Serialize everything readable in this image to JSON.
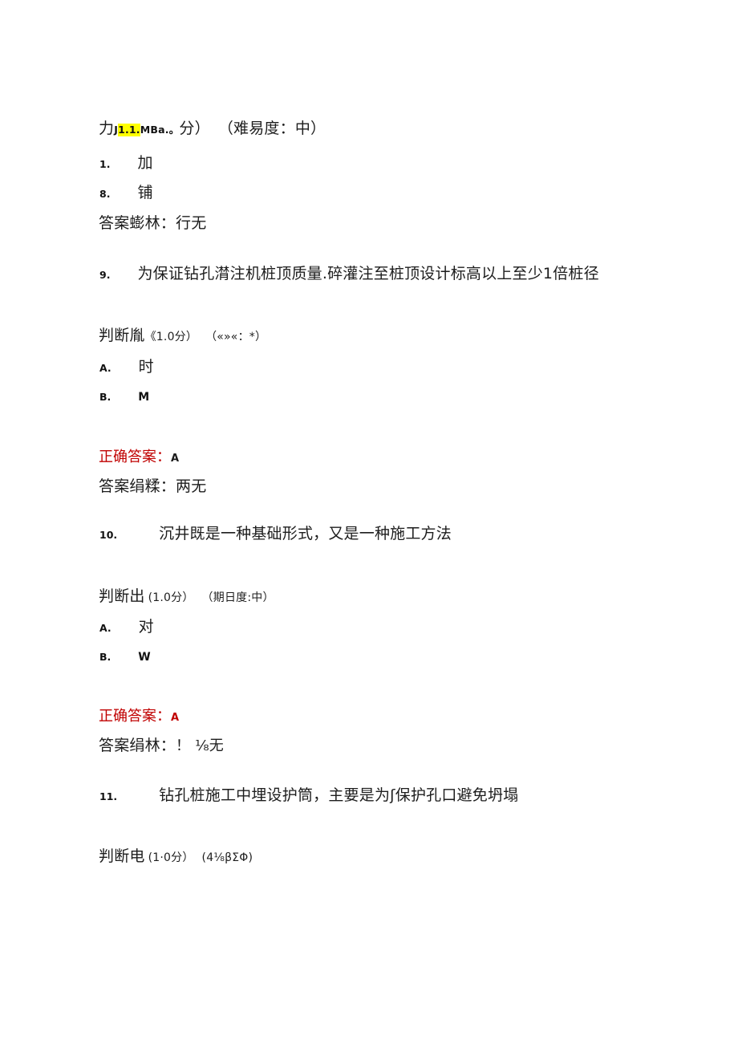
{
  "document": {
    "type": "scanned-exam-answer-sheet",
    "language": "zh-CN",
    "background_color": "#ffffff",
    "text_color": "#1d1d1d",
    "accent_color": "#c00000",
    "highlight_color": "#ffff00"
  },
  "top_fragment": {
    "lead": "力",
    "garbled_prefix": "J",
    "highlighted": "1.1.",
    "garbled_suffix": "MBa.。",
    "score_tail": "分）",
    "difficulty": "（难易度：中）"
  },
  "orphan_options": [
    {
      "marker": "1.",
      "text": "加"
    },
    {
      "marker": "8.",
      "text": "铺"
    }
  ],
  "orphan_analysis": {
    "label": "答案蟛林：",
    "value": "行无"
  },
  "questions": [
    {
      "number": "9.",
      "stem": "为保证钻孔潸注机桩顶质量.碎灌注至桩顶设计标高以上至少1倍桩径",
      "type_line": {
        "type": "判断胤",
        "score": "《1.0分）",
        "difficulty": "（«»«：*）"
      },
      "options": [
        {
          "marker": "A.",
          "text": "时",
          "size": "large"
        },
        {
          "marker": "B.",
          "text": "M",
          "size": "small"
        }
      ],
      "correct_answer": {
        "label": "正确答案：",
        "value": "A",
        "label_color": "#c00000",
        "value_color": "#1a1a1a"
      },
      "analysis": {
        "label": "答案绢糅：",
        "value": "两无"
      }
    },
    {
      "number": "10.",
      "stem": "沉井既是一种基础形式，又是一种施工方法",
      "type_line": {
        "type": "判断出",
        "score": "(1.0分）",
        "difficulty": "（期日度:中）"
      },
      "options": [
        {
          "marker": "A.",
          "text": "对",
          "size": "large"
        },
        {
          "marker": "B.",
          "text": "W",
          "size": "small"
        }
      ],
      "correct_answer": {
        "label": "正确答案：",
        "value": "A",
        "label_color": "#c00000",
        "value_color": "#c00000"
      },
      "analysis": {
        "label": "答案绢林：",
        "value": "！ ⅛无"
      }
    },
    {
      "number": "11.",
      "stem": "钻孔桩施工中埋设护筒，主要是为ʃ保护孔口避免坍塌",
      "type_line": {
        "type": "判断电",
        "score": "(1·0分）",
        "difficulty": "(4⅛βΣΦ)"
      },
      "options": [],
      "correct_answer": null,
      "analysis": null
    }
  ]
}
